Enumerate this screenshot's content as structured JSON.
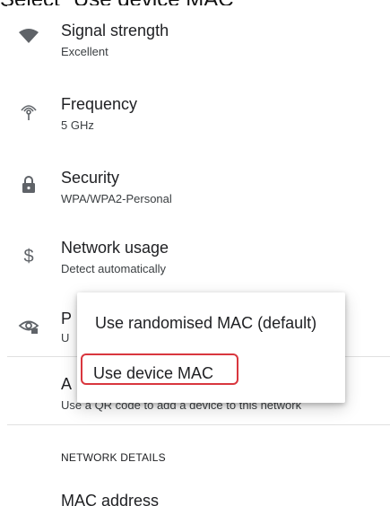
{
  "caption": "Select \"Use device MAC\"",
  "rows": [
    {
      "title": "Signal strength",
      "subtitle": "Excellent",
      "icon": "wifi-signal-icon"
    },
    {
      "title": "Frequency",
      "subtitle": "5 GHz",
      "icon": "frequency-icon"
    },
    {
      "title": "Security",
      "subtitle": "WPA/WPA2-Personal",
      "icon": "lock-icon"
    },
    {
      "title": "Network usage",
      "subtitle": "Detect automatically",
      "icon": "dollar-icon"
    },
    {
      "title": "P",
      "subtitle": "U",
      "icon": "privacy-eye-icon"
    },
    {
      "title": "A",
      "subtitle": "Use a QR code to add a device to this network",
      "icon": ""
    }
  ],
  "section_header": "NETWORK DETAILS",
  "mac_row_title": "MAC address",
  "popup": {
    "options": [
      "Use randomised MAC (default)",
      "Use device MAC"
    ]
  },
  "colors": {
    "highlight": "#d9363e",
    "icon": "#5f6368"
  }
}
